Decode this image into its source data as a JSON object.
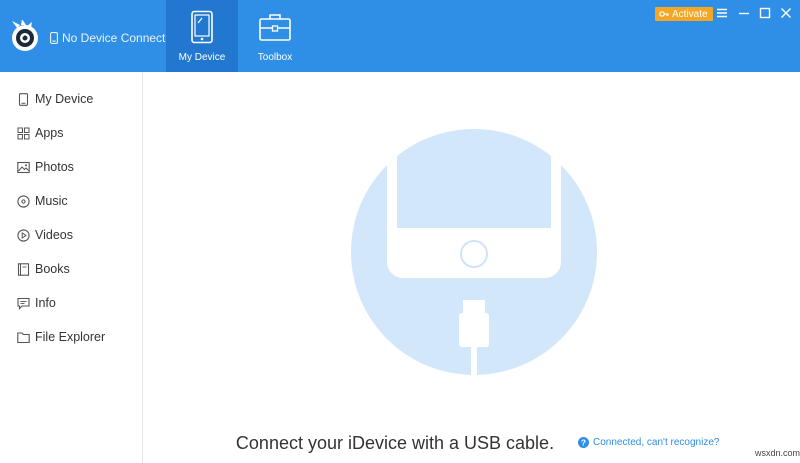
{
  "header": {
    "device_status": "No Device Connected",
    "tabs": [
      {
        "label": "My Device",
        "icon": "tablet-icon",
        "active": true
      },
      {
        "label": "Toolbox",
        "icon": "toolbox-icon",
        "active": false
      }
    ],
    "activate_label": "Activate",
    "window_buttons": [
      "menu-icon",
      "minimize-icon",
      "maximize-icon",
      "close-icon"
    ],
    "colors": {
      "header_bg": "#2f8ee6",
      "active_tab_bg": "#2278cf",
      "activate_bg": "#f5a623"
    }
  },
  "sidebar": {
    "items": [
      {
        "label": "My Device",
        "icon": "device-icon"
      },
      {
        "label": "Apps",
        "icon": "apps-grid-icon"
      },
      {
        "label": "Photos",
        "icon": "photo-icon"
      },
      {
        "label": "Music",
        "icon": "music-disc-icon"
      },
      {
        "label": "Videos",
        "icon": "play-circle-icon"
      },
      {
        "label": "Books",
        "icon": "book-icon"
      },
      {
        "label": "Info",
        "icon": "chat-info-icon"
      },
      {
        "label": "File Explorer",
        "icon": "folder-icon"
      }
    ]
  },
  "main": {
    "prompt": "Connect your iDevice with a USB cable.",
    "help_link": "Connected, can't recognize?",
    "colors": {
      "circle": "#d3e7fa",
      "accent": "#2f8ee6"
    }
  },
  "watermark": "wsxdn.com"
}
